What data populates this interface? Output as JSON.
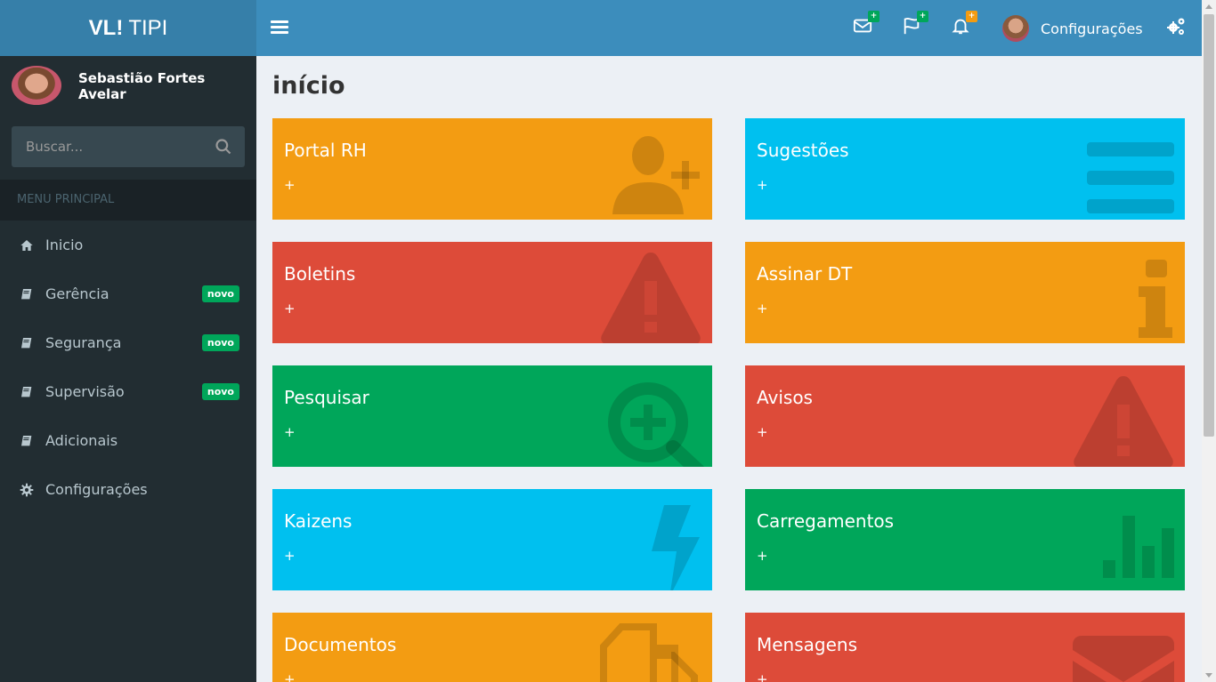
{
  "app": {
    "logo_bold": "VL!",
    "logo_rest": "TIPI"
  },
  "navbar": {
    "mail_badge": "+",
    "flag_badge": "+",
    "bell_badge": "+",
    "user_label": "Configurações"
  },
  "sidebar": {
    "user_name": "Sebastião Fortes Avelar",
    "search_placeholder": "Buscar...",
    "menu_header": "MENU PRINCIPAL",
    "items": [
      {
        "label": "Inicio",
        "icon": "home-icon"
      },
      {
        "label": "Gerência",
        "icon": "book-icon",
        "badge": "novo"
      },
      {
        "label": "Segurança",
        "icon": "book-icon",
        "badge": "novo"
      },
      {
        "label": "Supervisão",
        "icon": "book-icon",
        "badge": "novo"
      },
      {
        "label": "Adicionais",
        "icon": "book-icon"
      },
      {
        "label": "Configurações",
        "icon": "gear-icon"
      }
    ]
  },
  "main": {
    "title": "início",
    "boxes": [
      {
        "title": "Portal RH",
        "more": "+",
        "icon": "user-plus-icon"
      },
      {
        "title": "Sugestões",
        "more": "+",
        "icon": "list-icon"
      },
      {
        "title": "Boletins",
        "more": "+",
        "icon": "warning-icon"
      },
      {
        "title": "Assinar DT",
        "more": "+",
        "icon": "info-icon"
      },
      {
        "title": "Pesquisar",
        "more": "+",
        "icon": "zoom-in-icon"
      },
      {
        "title": "Avisos",
        "more": "+",
        "icon": "warning-icon"
      },
      {
        "title": "Kaizens",
        "more": "+",
        "icon": "bolt-icon"
      },
      {
        "title": "Carregamentos",
        "more": "+",
        "icon": "bar-chart-icon"
      },
      {
        "title": "Documentos",
        "more": "+",
        "icon": "files-icon"
      },
      {
        "title": "Mensagens",
        "more": "+",
        "icon": "envelope-icon"
      }
    ]
  },
  "colors": {
    "header": "#3c8dbc",
    "logo": "#367fa9",
    "sidebar": "#222d32",
    "orange": "#f39c12",
    "aqua": "#00c0ef",
    "red": "#dd4b39",
    "green": "#00a65a"
  }
}
